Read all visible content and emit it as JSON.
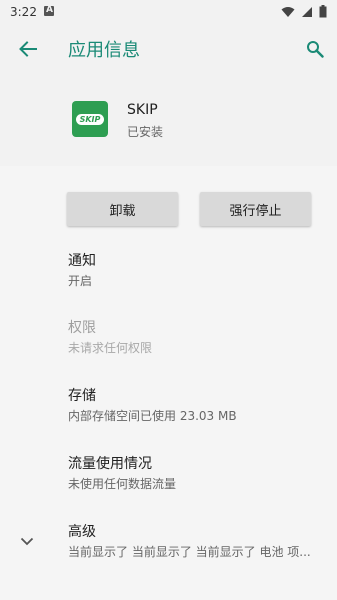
{
  "status_bar": {
    "time": "3:22",
    "notification_icon": "A"
  },
  "app_bar": {
    "title": "应用信息"
  },
  "app": {
    "name": "SKIP",
    "status": "已安装",
    "icon_text": "SKIP"
  },
  "buttons": {
    "uninstall": "卸载",
    "force_stop": "强行停止"
  },
  "prefs": {
    "notifications": {
      "title": "通知",
      "summary": "开启"
    },
    "permissions": {
      "title": "权限",
      "summary": "未请求任何权限"
    },
    "storage": {
      "title": "存储",
      "summary": "内部存储空间已使用 23.03 MB"
    },
    "data_usage": {
      "title": "流量使用情况",
      "summary": "未使用任何数据流量"
    },
    "advanced": {
      "title": "高级",
      "summary": "当前显示了 当前显示了 当前显示了 电池 项..."
    }
  },
  "colors": {
    "accent": "#1a8a76",
    "app_icon_bg": "#2e9e52"
  },
  "icons": [
    "back-arrow-icon",
    "search-icon",
    "wifi-icon",
    "signal-icon",
    "battery-icon",
    "chevron-down-icon"
  ]
}
